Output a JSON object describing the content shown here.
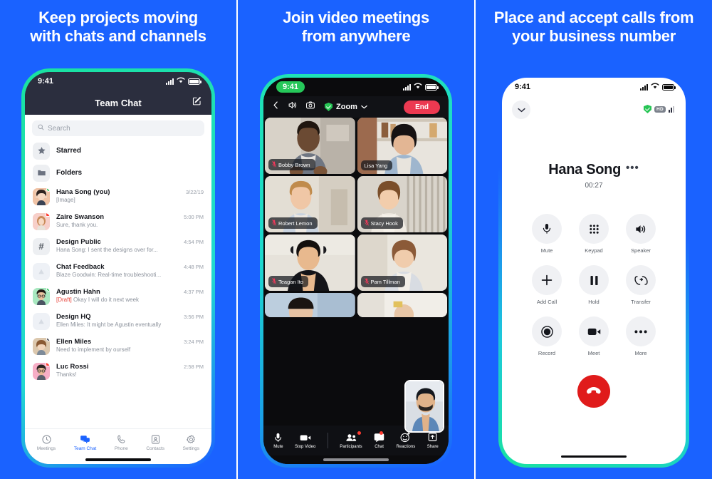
{
  "theme": {
    "background_blue": "#1A62FF",
    "accent_green": "#19E2A0",
    "end_red": "#EC3951",
    "hangup_red": "#E01B1B",
    "header_dark": "#2B2E3E",
    "draft_red": "#E8453C"
  },
  "panels": [
    {
      "id": "team-chat",
      "headline": "Keep projects moving\nwith chats and channels",
      "headline_line1": "Keep projects moving",
      "headline_line2": "with chats and channels",
      "status_bar": {
        "time": "9:41",
        "wifi_icon": "wifi-icon",
        "signal_icon": "signal-bars-icon",
        "battery_icon": "battery-icon"
      },
      "header": {
        "title": "Team Chat",
        "compose_icon": "compose-icon"
      },
      "search": {
        "placeholder": "Search",
        "icon": "search-icon"
      },
      "shortcuts": [
        {
          "label": "Starred",
          "icon": "star-icon"
        },
        {
          "label": "Folders",
          "icon": "folder-icon"
        }
      ],
      "chats": [
        {
          "name": "Hana Song (you)",
          "preview": "[Image]",
          "time": "3/22/19",
          "avatar": "photo-woman-dark-hair",
          "badge": "green-presence",
          "is_draft": false
        },
        {
          "name": "Zaire Swanson",
          "preview": "Sure, thank you.",
          "time": "5:00 PM",
          "avatar": "photo-woman-curly",
          "badge": "red-square",
          "is_draft": false
        },
        {
          "name": "Design Public",
          "preview": "Hana Song: I sent the designs over for...",
          "time": "4:54 PM",
          "avatar": "hash-icon",
          "badge": "none",
          "is_draft": false
        },
        {
          "name": "Chat Feedback",
          "preview": "Blaze Goodwin: Real-time troubleshooti...",
          "time": "4:48 PM",
          "avatar": "channel-icon",
          "badge": "none",
          "is_draft": false
        },
        {
          "name": "Agustin Hahn",
          "preview_prefix": "[Draft]",
          "preview": "Okay I will do it next week",
          "time": "4:37 PM",
          "avatar": "photo-man-glasses",
          "badge": "green-presence",
          "is_draft": true
        },
        {
          "name": "Design HQ",
          "preview": "Ellen Miles: It might be Agustin eventually",
          "time": "3:56 PM",
          "avatar": "channel-icon",
          "badge": "none",
          "is_draft": false
        },
        {
          "name": "Ellen Miles",
          "preview": "Need to implement by ourself",
          "time": "3:24 PM",
          "avatar": "photo-woman-smiling",
          "badge": "dark-count",
          "is_draft": false
        },
        {
          "name": "Luc Rossi",
          "preview": "Thanks!",
          "time": "2:58 PM",
          "avatar": "photo-man-beard",
          "badge": "red-square",
          "is_draft": false
        }
      ],
      "tabs": [
        {
          "label": "Meetings",
          "icon": "clock-icon",
          "active": false
        },
        {
          "label": "Team Chat",
          "icon": "chat-bubbles-icon",
          "active": true
        },
        {
          "label": "Phone",
          "icon": "phone-icon",
          "active": false
        },
        {
          "label": "Contacts",
          "icon": "contacts-icon",
          "active": false
        },
        {
          "label": "Settings",
          "icon": "gear-icon",
          "active": false
        }
      ]
    },
    {
      "id": "video-meeting",
      "headline_line1": "Join video meetings",
      "headline_line2": "from anywhere",
      "status_bar": {
        "time": "9:41",
        "time_pill_color": "#26C85A",
        "wifi_icon": "wifi-icon",
        "signal_icon": "signal-bars-icon",
        "battery_icon": "battery-icon"
      },
      "toolbar": {
        "back_icon": "chevron-left-icon",
        "speaker_icon": "speaker-icon",
        "flip_camera_icon": "flip-camera-icon",
        "shield_icon": "encryption-shield-icon",
        "brand": "Zoom",
        "chevron_icon": "chevron-down-icon",
        "end_label": "End"
      },
      "participants": [
        {
          "name": "Bobby Brown",
          "muted": true,
          "tile": "video-tile"
        },
        {
          "name": "Lisa Yang",
          "muted": false,
          "tile": "video-tile"
        },
        {
          "name": "Robert Lemon",
          "muted": true,
          "tile": "video-tile"
        },
        {
          "name": "Stacy Hook",
          "muted": true,
          "tile": "video-tile"
        },
        {
          "name": "Teagan Ito",
          "muted": true,
          "tile": "video-tile"
        },
        {
          "name": "Pam Tillman",
          "muted": true,
          "tile": "video-tile"
        }
      ],
      "self_view": {
        "label": "self-view-pip"
      },
      "controls": [
        {
          "label": "Mute",
          "icon": "microphone-icon",
          "badge": false
        },
        {
          "label": "Stop Video",
          "icon": "video-camera-icon",
          "badge": false
        },
        {
          "label": "Participants",
          "icon": "participants-icon",
          "badge": true
        },
        {
          "label": "Chat",
          "icon": "chat-bubble-icon",
          "badge": true
        },
        {
          "label": "Reactions",
          "icon": "reactions-icon",
          "badge": false
        },
        {
          "label": "Share",
          "icon": "share-icon",
          "badge": false
        }
      ]
    },
    {
      "id": "phone-call",
      "headline_line1": "Place and accept calls from",
      "headline_line2": "your business number",
      "status_bar": {
        "time": "9:41",
        "wifi_icon": "wifi-icon",
        "signal_icon": "signal-bars-icon",
        "battery_icon": "battery-icon"
      },
      "minimize_icon": "chevron-down-icon",
      "badges": {
        "shield_icon": "encryption-shield-icon",
        "hd_label": "HD",
        "signal_icon": "call-quality-icon"
      },
      "caller": {
        "name": "Hana Song",
        "more_icon": "more-dots-icon",
        "duration": "00:27"
      },
      "controls": [
        {
          "label": "Mute",
          "icon": "microphone-icon"
        },
        {
          "label": "Keypad",
          "icon": "keypad-icon"
        },
        {
          "label": "Speaker",
          "icon": "speaker-icon"
        },
        {
          "label": "Add Call",
          "icon": "plus-icon"
        },
        {
          "label": "Hold",
          "icon": "pause-icon"
        },
        {
          "label": "Transfer",
          "icon": "transfer-icon"
        },
        {
          "label": "Record",
          "icon": "record-icon"
        },
        {
          "label": "Meet",
          "icon": "video-camera-icon"
        },
        {
          "label": "More",
          "icon": "more-dots-icon"
        }
      ],
      "hangup": {
        "icon": "hangup-icon",
        "color": "#E01B1B"
      }
    }
  ]
}
